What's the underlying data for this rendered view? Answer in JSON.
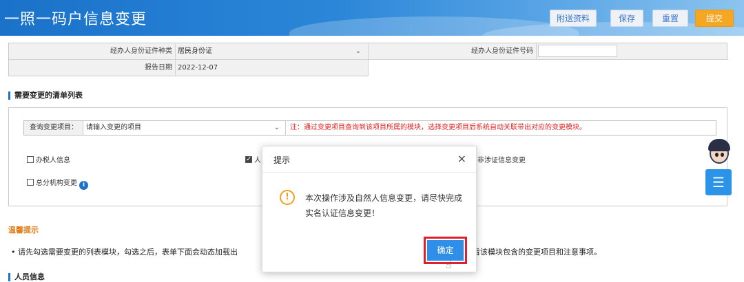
{
  "header": {
    "title": "一照一码户信息变更",
    "buttons": {
      "attach": "附送资料",
      "save": "保存",
      "reset": "重置",
      "submit": "提交"
    }
  },
  "form": {
    "id_type_label": "经办人身份证件种类",
    "id_type_value": "居民身份证",
    "id_number_label": "经办人身份证件号码",
    "id_number_value": "",
    "report_date_label": "报告日期",
    "report_date_value": "2022-12-07"
  },
  "change_list": {
    "title": "需要变更的清单列表",
    "query_label": "查询变更项目：",
    "query_placeholder": "请输入变更的项目",
    "query_note": "注：通过变更项目查询到该项目所属的模块，选择变更项目后系统自动关联带出对应的变更模块。",
    "checkboxes": [
      {
        "label": "办税人信息",
        "checked": false
      },
      {
        "label": "人",
        "checked": true
      },
      {
        "label": "非涉证信息变更",
        "checked": false
      },
      {
        "label": "总分机构变更",
        "checked": false
      }
    ]
  },
  "tips": {
    "title": "温馨提示",
    "text_left": "• 请先勾选需要变更的列表模块，勾选之后，表单下面会动态加载出",
    "text_right": "查看该模块包含的变更项目和注意事项。"
  },
  "persons_section": {
    "title": "人员信息"
  },
  "modal": {
    "title": "提示",
    "close": "×",
    "message": "本次操作涉及自然人信息变更，请尽快完成实名认证信息变更！",
    "confirm": "确定"
  },
  "colors": {
    "header_blue": "#1a72c9",
    "submit_orange": "#f5a623",
    "confirm_blue": "#2f8ee8",
    "highlight_red": "#e0202a",
    "tip_orange": "#e07c17"
  }
}
